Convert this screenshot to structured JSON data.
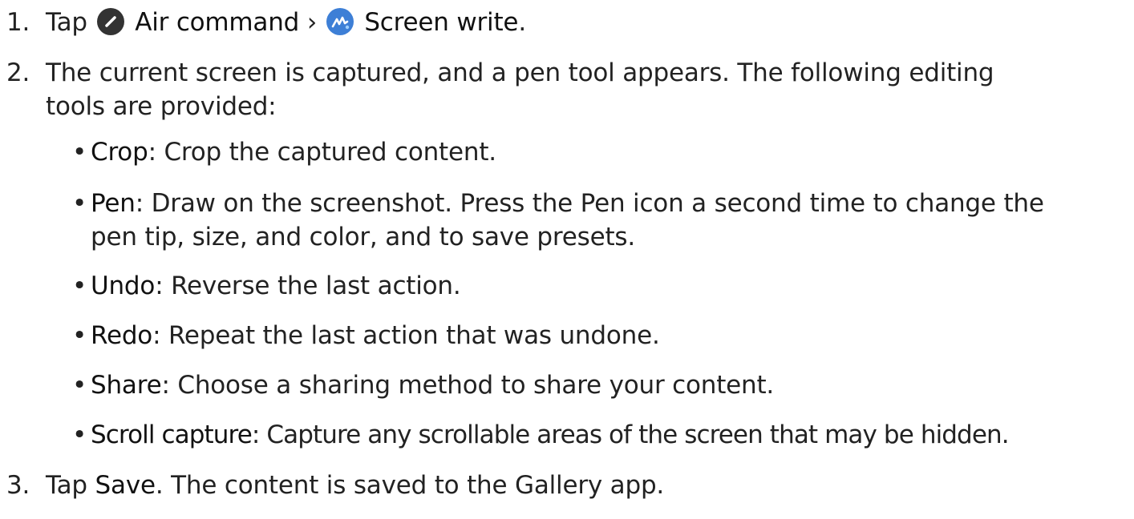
{
  "steps": [
    {
      "number": "1.",
      "parts": {
        "tap": "Tap",
        "air_command": "Air command",
        "sep": "›",
        "screen_write": "Screen write",
        "end": "."
      }
    },
    {
      "number": "2.",
      "line1": "The current screen is captured, and a pen tool appears. The following editing",
      "line2": "tools are provided:"
    },
    {
      "number": "3.",
      "tap": "Tap",
      "save": "Save",
      "rest": ". The content is saved to the Gallery app."
    }
  ],
  "bullets": [
    {
      "term": "Crop",
      "text": ": Crop the captured content."
    },
    {
      "term": "Pen",
      "text": ": Draw on the screenshot. Press the Pen icon a second time to change the",
      "text2": "pen tip, size, and color, and to save presets."
    },
    {
      "term": "Undo",
      "text": ": Reverse the last action."
    },
    {
      "term": "Redo",
      "text": ": Repeat the last action that was undone."
    },
    {
      "term": "Share",
      "text": ": Choose a sharing method to share your content."
    },
    {
      "term": "Scroll capture",
      "text": ": Capture any scrollable areas of the screen that may be hidden."
    }
  ],
  "bullet_char": "•",
  "icons": {
    "air_command": {
      "name": "air-command-icon",
      "bg": "#333333",
      "fg": "#ffffff"
    },
    "screen_write": {
      "name": "screen-write-icon",
      "bg": "#3d7fd6",
      "fg": "#ffffff"
    }
  }
}
